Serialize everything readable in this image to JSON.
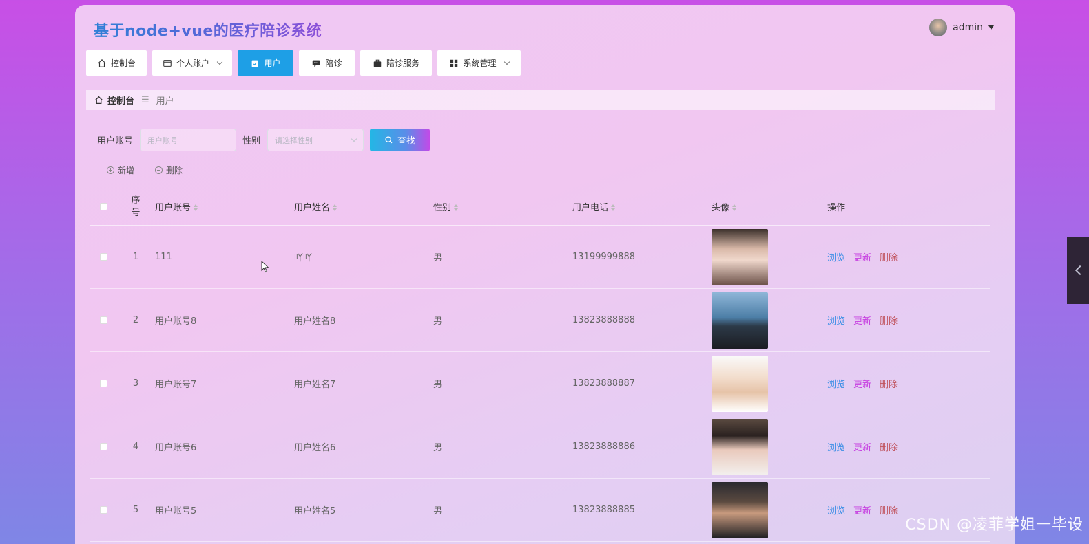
{
  "header": {
    "title": "基于node+vue的医疗陪诊系统",
    "user": "admin"
  },
  "nav": [
    {
      "label": "控制台",
      "icon": "home-icon"
    },
    {
      "label": "个人账户",
      "icon": "card-icon",
      "dropdown": true
    },
    {
      "label": "用户",
      "icon": "clipboard-icon",
      "active": true
    },
    {
      "label": "陪诊",
      "icon": "chat-icon"
    },
    {
      "label": "陪诊服务",
      "icon": "briefcase-icon"
    },
    {
      "label": "系统管理",
      "icon": "grid-icon",
      "dropdown": true
    }
  ],
  "breadcrumb": {
    "home": "控制台",
    "current": "用户"
  },
  "search": {
    "account_label": "用户账号",
    "account_placeholder": "用户账号",
    "sex_label": "性别",
    "sex_placeholder": "请选择性别",
    "button": "查找"
  },
  "actions": {
    "add": "新增",
    "delete": "删除"
  },
  "table": {
    "headers": {
      "index": "序号",
      "account": "用户账号",
      "name": "用户姓名",
      "sex": "性别",
      "phone": "用户电话",
      "avatar": "头像",
      "ops": "操作"
    },
    "ops": {
      "view": "浏览",
      "edit": "更新",
      "del": "删除"
    },
    "rows": [
      {
        "index": "1",
        "account": "111",
        "name": "吖吖",
        "sex": "男",
        "phone": "13199999888",
        "avatar": "avatar-photo-1"
      },
      {
        "index": "2",
        "account": "用户账号8",
        "name": "用户姓名8",
        "sex": "男",
        "phone": "13823888888",
        "avatar": "avatar-photo-2"
      },
      {
        "index": "3",
        "account": "用户账号7",
        "name": "用户姓名7",
        "sex": "男",
        "phone": "13823888887",
        "avatar": "avatar-photo-3"
      },
      {
        "index": "4",
        "account": "用户账号6",
        "name": "用户姓名6",
        "sex": "男",
        "phone": "13823888886",
        "avatar": "avatar-photo-4"
      },
      {
        "index": "5",
        "account": "用户账号5",
        "name": "用户姓名5",
        "sex": "男",
        "phone": "13823888885",
        "avatar": "avatar-photo-5"
      }
    ]
  },
  "watermark": "CSDN @凌菲学姐一毕设"
}
